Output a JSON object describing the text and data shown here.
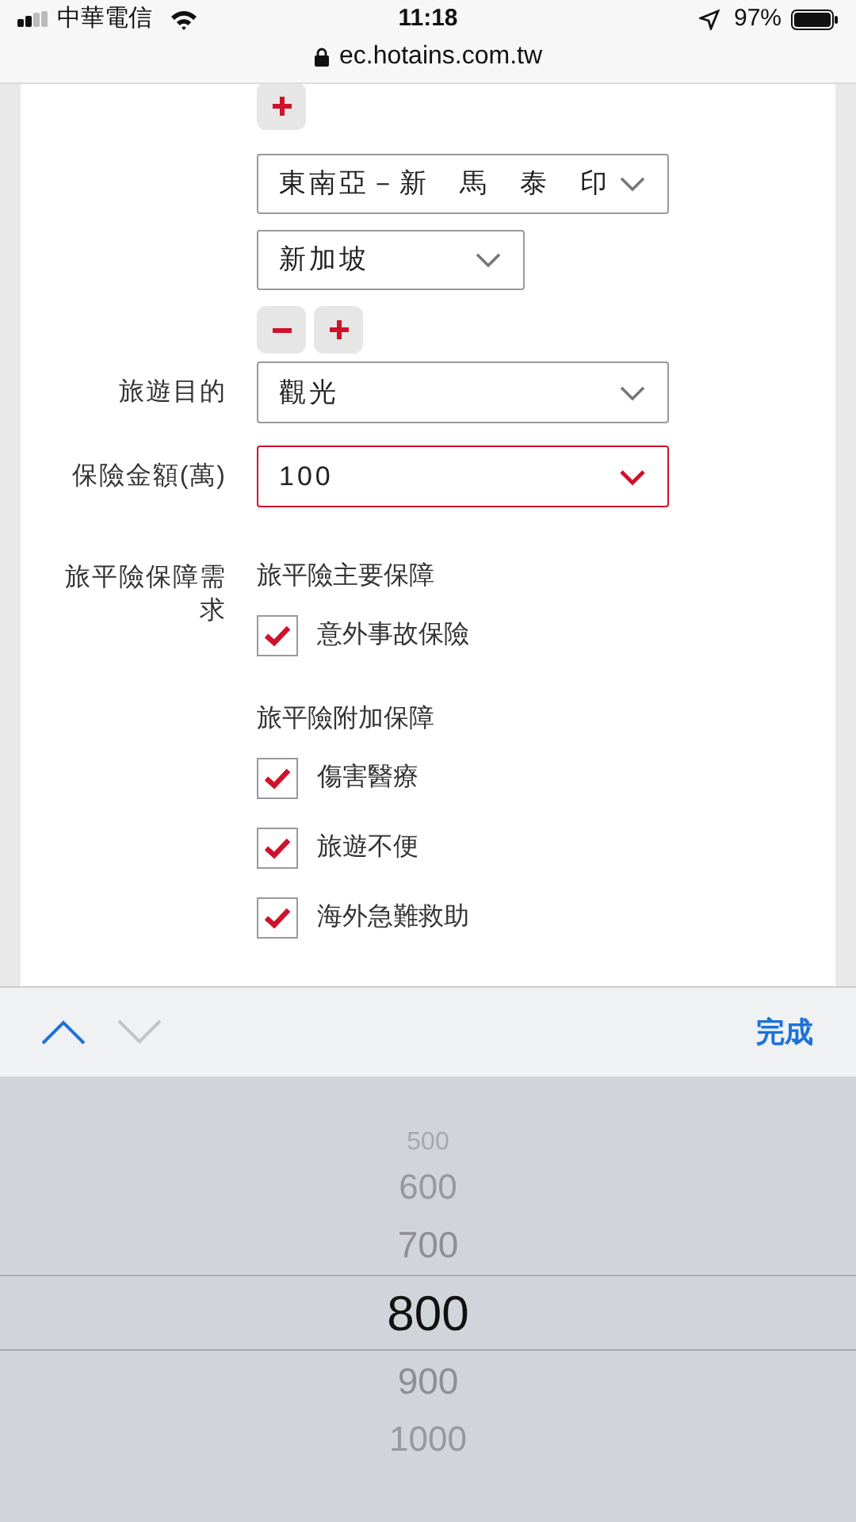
{
  "status_bar": {
    "carrier": "中華電信",
    "time": "11:18",
    "battery": "97%"
  },
  "address_bar": {
    "url": "ec.hotains.com.tw"
  },
  "form": {
    "top_button": {
      "kind": "add"
    },
    "region_selects": [
      {
        "value": "東南亞－新　馬　泰　印",
        "wide": true
      },
      {
        "value": "新加坡",
        "wide": false
      }
    ],
    "row_buttons": [
      {
        "kind": "remove"
      },
      {
        "kind": "add"
      }
    ],
    "fields": [
      {
        "label": "旅遊目的",
        "value": "觀光",
        "focused": false
      },
      {
        "label": "保險金額(萬)",
        "value": "100",
        "focused": true
      }
    ],
    "coverage": {
      "label": "旅平險保障需求",
      "groups": [
        {
          "title": "旅平險主要保障",
          "items": [
            {
              "label": "意外事故保險",
              "checked": true
            }
          ]
        },
        {
          "title": "旅平險附加保障",
          "items": [
            {
              "label": "傷害醫療",
              "checked": true
            },
            {
              "label": "旅遊不便",
              "checked": true
            },
            {
              "label": "海外急難救助",
              "checked": true
            }
          ]
        }
      ]
    }
  },
  "keyboard_toolbar": {
    "previous_enabled": true,
    "next_enabled": false,
    "done": "完成"
  },
  "picker": {
    "items": [
      {
        "label": "500",
        "selected": false
      },
      {
        "label": "600",
        "selected": false
      },
      {
        "label": "700",
        "selected": false
      },
      {
        "label": "800",
        "selected": true
      },
      {
        "label": "900",
        "selected": false
      },
      {
        "label": "1000",
        "selected": false
      }
    ]
  }
}
